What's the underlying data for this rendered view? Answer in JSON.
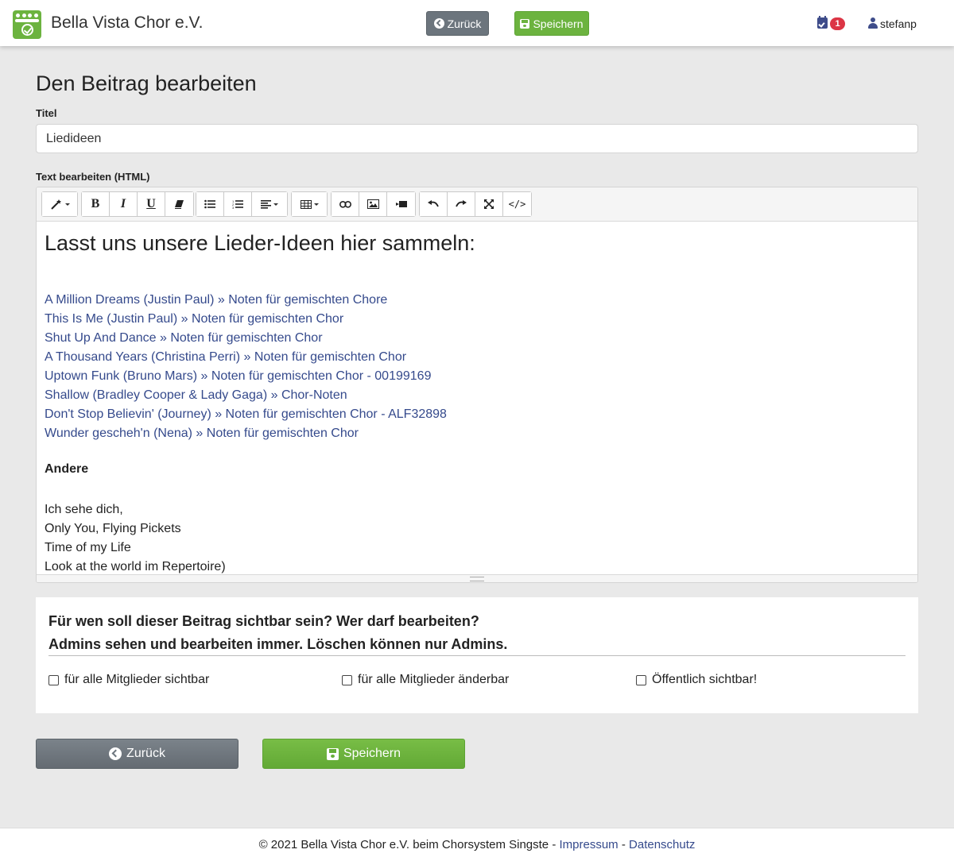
{
  "header": {
    "brand": "Bella Vista Chor e.V.",
    "back_label": "Zurück",
    "save_label": "Speichern",
    "notification_count": "1",
    "username": "stefanp"
  },
  "form": {
    "heading": "Den Beitrag bearbeiten",
    "title_label": "Titel",
    "title_value": "Liedideen",
    "text_label": "Text bearbeiten (HTML)"
  },
  "toolbar": {
    "bold": "B",
    "italic": "I",
    "underline": "U",
    "code": "</>"
  },
  "content": {
    "heading": "Lasst uns unsere Lieder-Ideen hier sammeln:",
    "songs": [
      "A Million Dreams (Justin Paul) » Noten für gemischten Chore",
      "This Is Me (Justin Paul) » Noten für gemischten Chor",
      "Shut Up And Dance » Noten für gemischten Chor",
      "A Thousand Years (Christina Perri) » Noten für gemischten Chor",
      "Uptown Funk (Bruno Mars) » Noten für gemischten Chor - 00199169",
      "Shallow (Bradley Cooper & Lady Gaga) » Chor-Noten",
      "Don't Stop Believin' (Journey) » Noten für gemischten Chor - ALF32898",
      "Wunder gescheh'n (Nena) » Noten für gemischten Chor"
    ],
    "others_heading": "Andere",
    "others": [
      "Ich sehe dich,",
      "Only You, Flying Pickets",
      "Time of my Life",
      "Look at the world im Repertoire)"
    ]
  },
  "visibility": {
    "question": "Für wen soll dieser Beitrag sichtbar sein? Wer darf bearbeiten?",
    "note": "Admins sehen und bearbeiten immer. Löschen können nur Admins.",
    "options": [
      "für alle Mitglieder sichtbar",
      "für alle Mitglieder änderbar",
      "Öffentlich sichtbar!"
    ]
  },
  "actions": {
    "back_label": "Zurück",
    "save_label": "Speichern"
  },
  "footer": {
    "text": "© 2021 Bella Vista Chor e.V. beim Chorsystem Singste",
    "sep1": " - ",
    "impressum": "Impressum",
    "sep2": " - ",
    "datenschutz": "Datenschutz"
  },
  "colors": {
    "accent_green": "#6cb33f",
    "link_blue": "#354a8c",
    "badge_red": "#dc3545",
    "secondary_gray": "#6c757d"
  }
}
